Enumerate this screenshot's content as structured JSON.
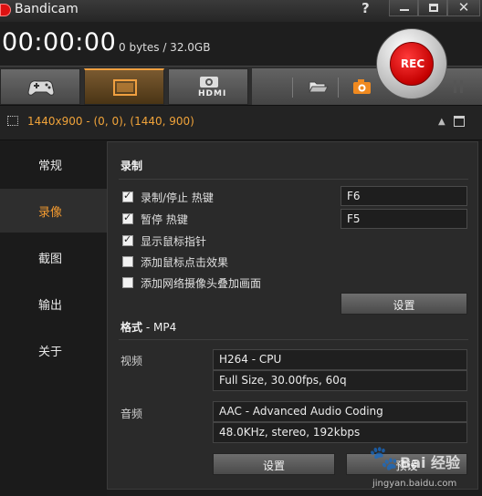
{
  "window": {
    "title": "Bandicam",
    "help": "?",
    "close": "✕"
  },
  "status": {
    "timer": "00:00:00",
    "file_size": "0 bytes / 32.0GB"
  },
  "toolbar": {
    "modes": [
      {
        "name": "game-mode",
        "icon": "gamepad-icon"
      },
      {
        "name": "screen-mode",
        "icon": "monitor-icon",
        "active": true
      },
      {
        "name": "hdmi-mode",
        "icon": "hdmi-device-icon",
        "label": "HDMI"
      }
    ],
    "tools": [
      "folder-icon",
      "camera-icon"
    ],
    "rec_label": "REC",
    "pause_icon": "pause-icon"
  },
  "region": {
    "text": "1440x900 - (0, 0), (1440, 900)"
  },
  "sidebar": {
    "items": [
      {
        "label": "常规"
      },
      {
        "label": "录像",
        "active": true
      },
      {
        "label": "截图"
      },
      {
        "label": "输出"
      },
      {
        "label": "关于"
      }
    ]
  },
  "record": {
    "title": "录制",
    "options": [
      {
        "label": "录制/停止 热键",
        "checked": true,
        "hotkey": "F6"
      },
      {
        "label": "暂停 热键",
        "checked": true,
        "hotkey": "F5"
      },
      {
        "label": "显示鼠标指针",
        "checked": true
      },
      {
        "label": "添加鼠标点击效果",
        "checked": false
      },
      {
        "label": "添加网络摄像头叠加画面",
        "checked": false
      }
    ],
    "settings_label": "设置"
  },
  "format": {
    "title": "格式",
    "subtitle": " - MP4",
    "video_label": "视频",
    "video_codec": "H264 - CPU",
    "video_details": "Full Size, 30.00fps, 60q",
    "audio_label": "音频",
    "audio_codec": "AAC - Advanced Audio Coding",
    "audio_details": "48.0KHz, stereo, 192kbps",
    "settings_label": "设置",
    "preset_label": "预设"
  },
  "watermark": {
    "paw": "🐾",
    "title": "Bai 经验",
    "url": "jingyan.baidu.com"
  },
  "colors": {
    "accent": "#f39a30",
    "rec": "#d40000",
    "background": "#2a2a2a"
  }
}
